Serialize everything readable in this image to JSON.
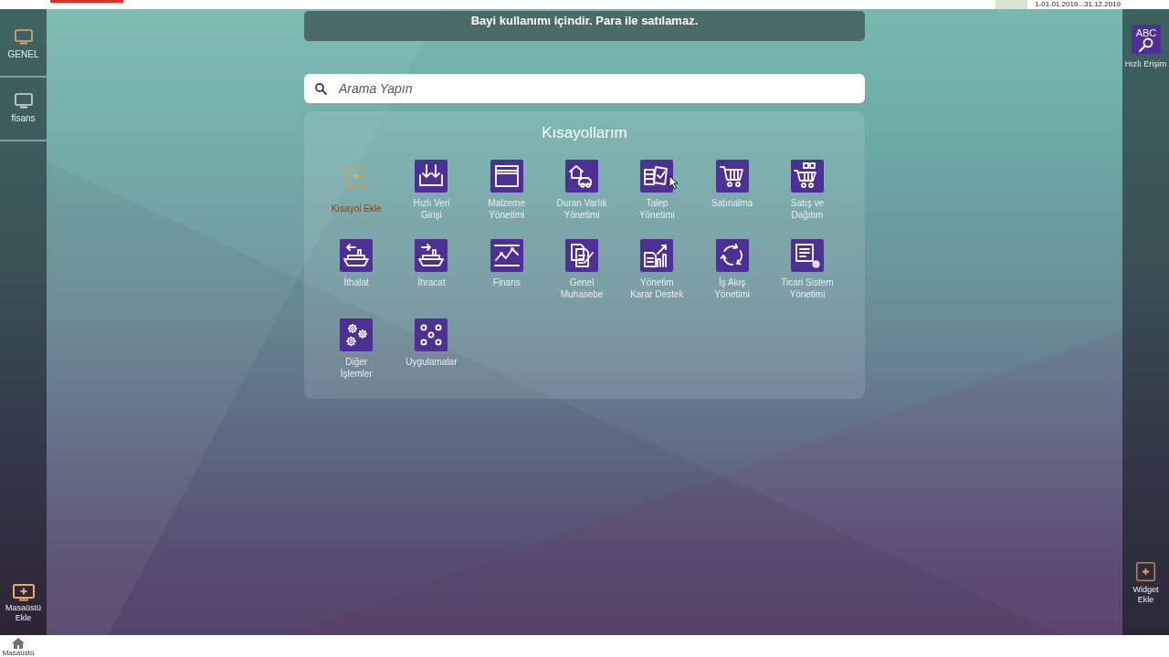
{
  "top_bar": {
    "period": "1-01.01.2019...31.12.2019"
  },
  "left_sidebar": {
    "items": [
      {
        "label": "GENEL",
        "selected": true
      },
      {
        "label": "fisans",
        "selected": false
      }
    ],
    "add_desktop": {
      "label": "Masaüstü Ekle"
    }
  },
  "notice": {
    "text": "Bayi kullanımı içindir. Para ile satılamaz."
  },
  "search": {
    "placeholder": "Arama Yapın"
  },
  "shortcuts": {
    "title": "Kısayollarım",
    "items": [
      {
        "kind": "add",
        "label": "Kısayol Ekle"
      },
      {
        "kind": "app",
        "label": "Hızlı Veri Girişi"
      },
      {
        "kind": "app",
        "label": "Malzeme Yönetimi"
      },
      {
        "kind": "app",
        "label": "Duran Varlık Yönetimi"
      },
      {
        "kind": "app",
        "label": "Talep Yönetimi"
      },
      {
        "kind": "app",
        "label": "Satınalma"
      },
      {
        "kind": "app",
        "label": "Satış ve Dağıtım"
      },
      {
        "kind": "app",
        "label": "İthalat"
      },
      {
        "kind": "app",
        "label": "İhracat"
      },
      {
        "kind": "app",
        "label": "Finans"
      },
      {
        "kind": "app",
        "label": "Genel Muhasebe"
      },
      {
        "kind": "app",
        "label": "Yönetim Karar Destek"
      },
      {
        "kind": "app",
        "label": "İş Akış Yönetimi"
      },
      {
        "kind": "app",
        "label": "Ticari Sistem Yönetimi"
      },
      {
        "kind": "app",
        "label": "Diğer İşlemler"
      },
      {
        "kind": "app",
        "label": "Uygulamalar"
      }
    ]
  },
  "right_sidebar": {
    "quick_access": {
      "icon_text": "ABC",
      "label": "Hızlı Erişim"
    },
    "add_widget": {
      "label": "Widget Ekle"
    }
  },
  "taskbar": {
    "items": [
      {
        "label": "Masaüstü"
      }
    ]
  }
}
